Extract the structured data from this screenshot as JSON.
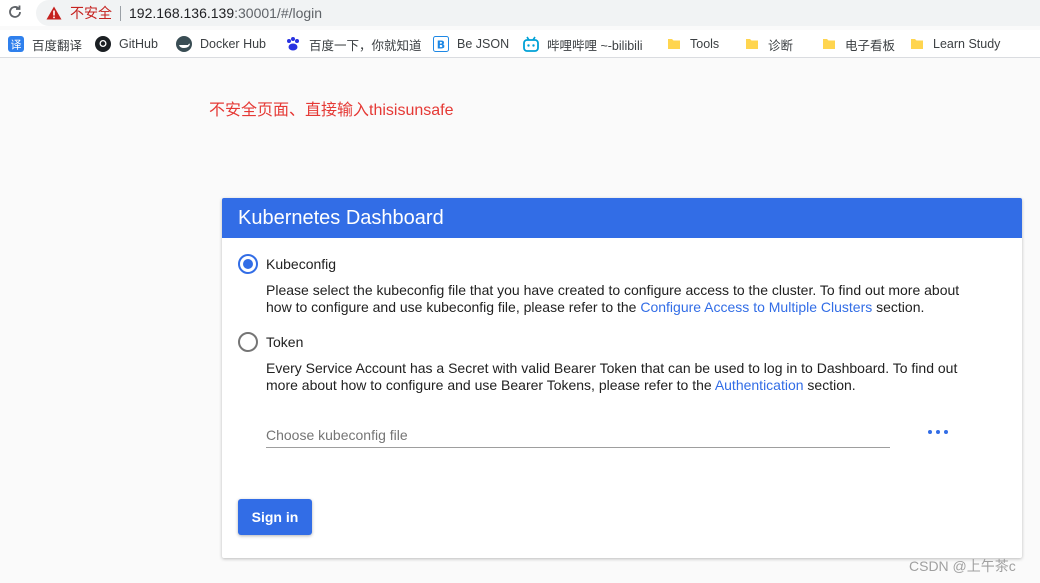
{
  "browser": {
    "security_label": "不安全",
    "url_host": "192.168.136.139",
    "url_path": ":30001/#/login"
  },
  "bookmarks": [
    {
      "label": "百度翻译",
      "icon": "translate-icon"
    },
    {
      "label": "GitHub",
      "icon": "github-icon"
    },
    {
      "label": "Docker Hub",
      "icon": "docker-icon"
    },
    {
      "label": "百度一下，你就知道",
      "icon": "baidu-icon"
    },
    {
      "label": "Be JSON",
      "icon": "json-icon"
    },
    {
      "label": "哔哩哔哩 ~-bilibili",
      "icon": "bilibili-icon"
    },
    {
      "label": "Tools",
      "icon": "folder-icon"
    },
    {
      "label": "诊断",
      "icon": "folder-icon"
    },
    {
      "label": "电子看板",
      "icon": "folder-icon"
    },
    {
      "label": "Learn Study",
      "icon": "folder-icon"
    }
  ],
  "annotation": "不安全页面、直接输入thisisunsafe",
  "login": {
    "title": "Kubernetes Dashboard",
    "kubeconfig": {
      "label": "Kubeconfig",
      "selected": true,
      "desc_before": "Please select the kubeconfig file that you have created to configure access to the cluster. To find out more about how to configure and use kubeconfig file, please refer to the ",
      "link": "Configure Access to Multiple Clusters",
      "desc_after": " section."
    },
    "token": {
      "label": "Token",
      "selected": false,
      "desc_before": "Every Service Account has a Secret with valid Bearer Token that can be used to log in to Dashboard. To find out more about how to configure and use Bearer Tokens, please refer to the ",
      "link": "Authentication",
      "desc_after": " section."
    },
    "file_placeholder": "Choose kubeconfig file",
    "signin_label": "Sign in"
  },
  "watermark": "CSDN @上午茶c",
  "colors": {
    "primary": "#326de6",
    "insecure": "#c5221f",
    "annotation": "#e53935"
  }
}
